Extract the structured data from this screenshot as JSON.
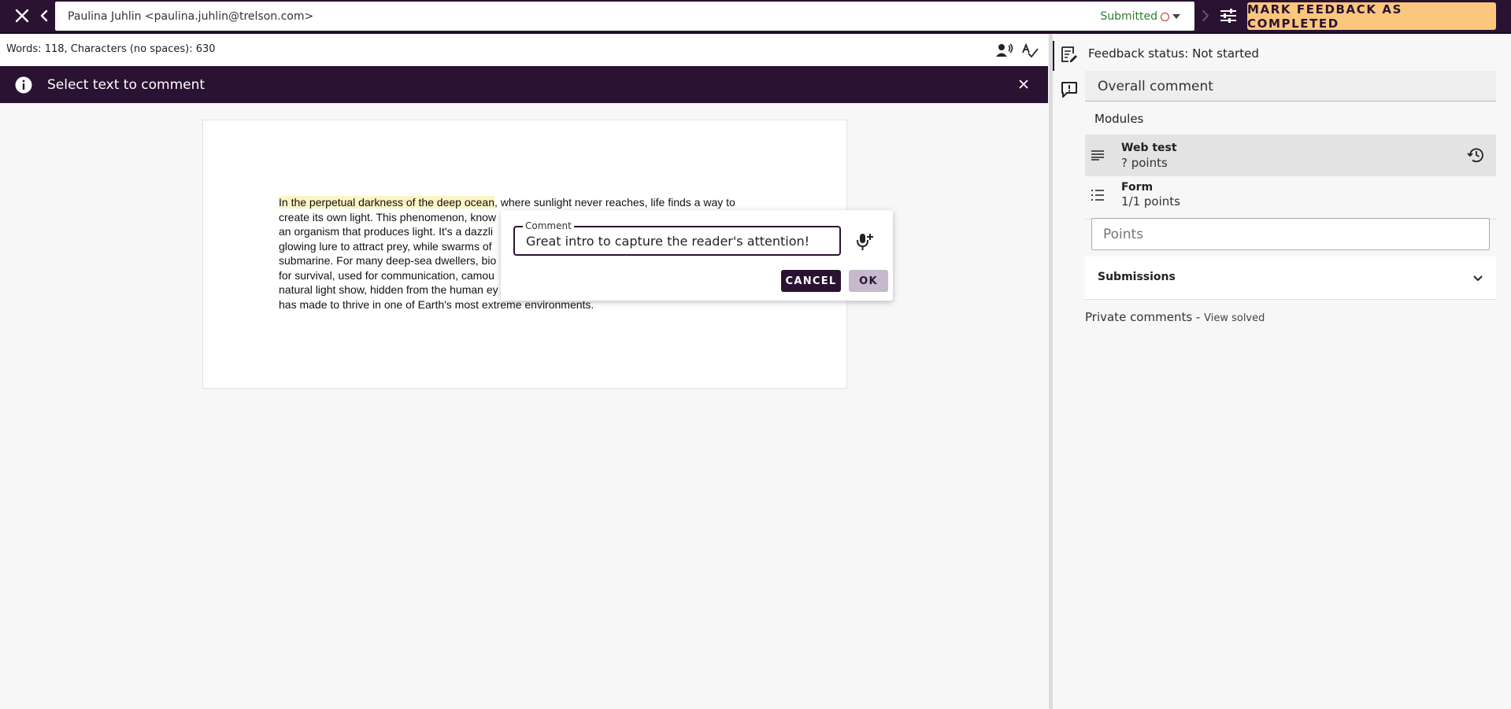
{
  "topbar": {
    "student": "Paulina Juhlin <paulina.juhlin@trelson.com>",
    "status": "Submitted",
    "mark_button": "MARK FEEDBACK AS COMPLETED"
  },
  "editor": {
    "word_count": "Words: 118, Characters (no spaces): 630",
    "banner": "Select text to comment",
    "document": {
      "highlighted": "In the perpetual darkness of the deep ocean",
      "lines": [
        ", where sunlight never reaches, life finds a way to",
        "create its own light. This phenomenon, know",
        "an organism that produces light. It's a dazzli",
        "glowing lure to attract prey, while swarms of",
        "submarine. For many deep-sea dwellers, bio",
        "for survival, used for communication, camou",
        "natural light show, hidden from the human ey",
        "has made to thrive in one of Earth's most extreme environments."
      ]
    },
    "comment_popup": {
      "legend": "Comment",
      "value": "Great intro to capture the reader's attention!",
      "cancel": "CANCEL",
      "ok": "OK"
    }
  },
  "sidebar": {
    "feedback_status": "Feedback status: Not started",
    "overall_comment": "Overall comment",
    "modules_heading": "Modules",
    "modules": [
      {
        "title": "Web test",
        "points": "? points",
        "icon": "lines-icon"
      },
      {
        "title": "Form",
        "points": "1/1 points",
        "icon": "list-icon"
      }
    ],
    "points_placeholder": "Points",
    "submissions": "Submissions",
    "private_comments": "Private comments -",
    "view_solved": "View solved"
  },
  "colors": {
    "brand_dark": "#2a1233",
    "accent": "#fbc77e",
    "status_green": "#2e7d32",
    "status_red": "#c62828",
    "highlight": "#fbf4c4"
  }
}
